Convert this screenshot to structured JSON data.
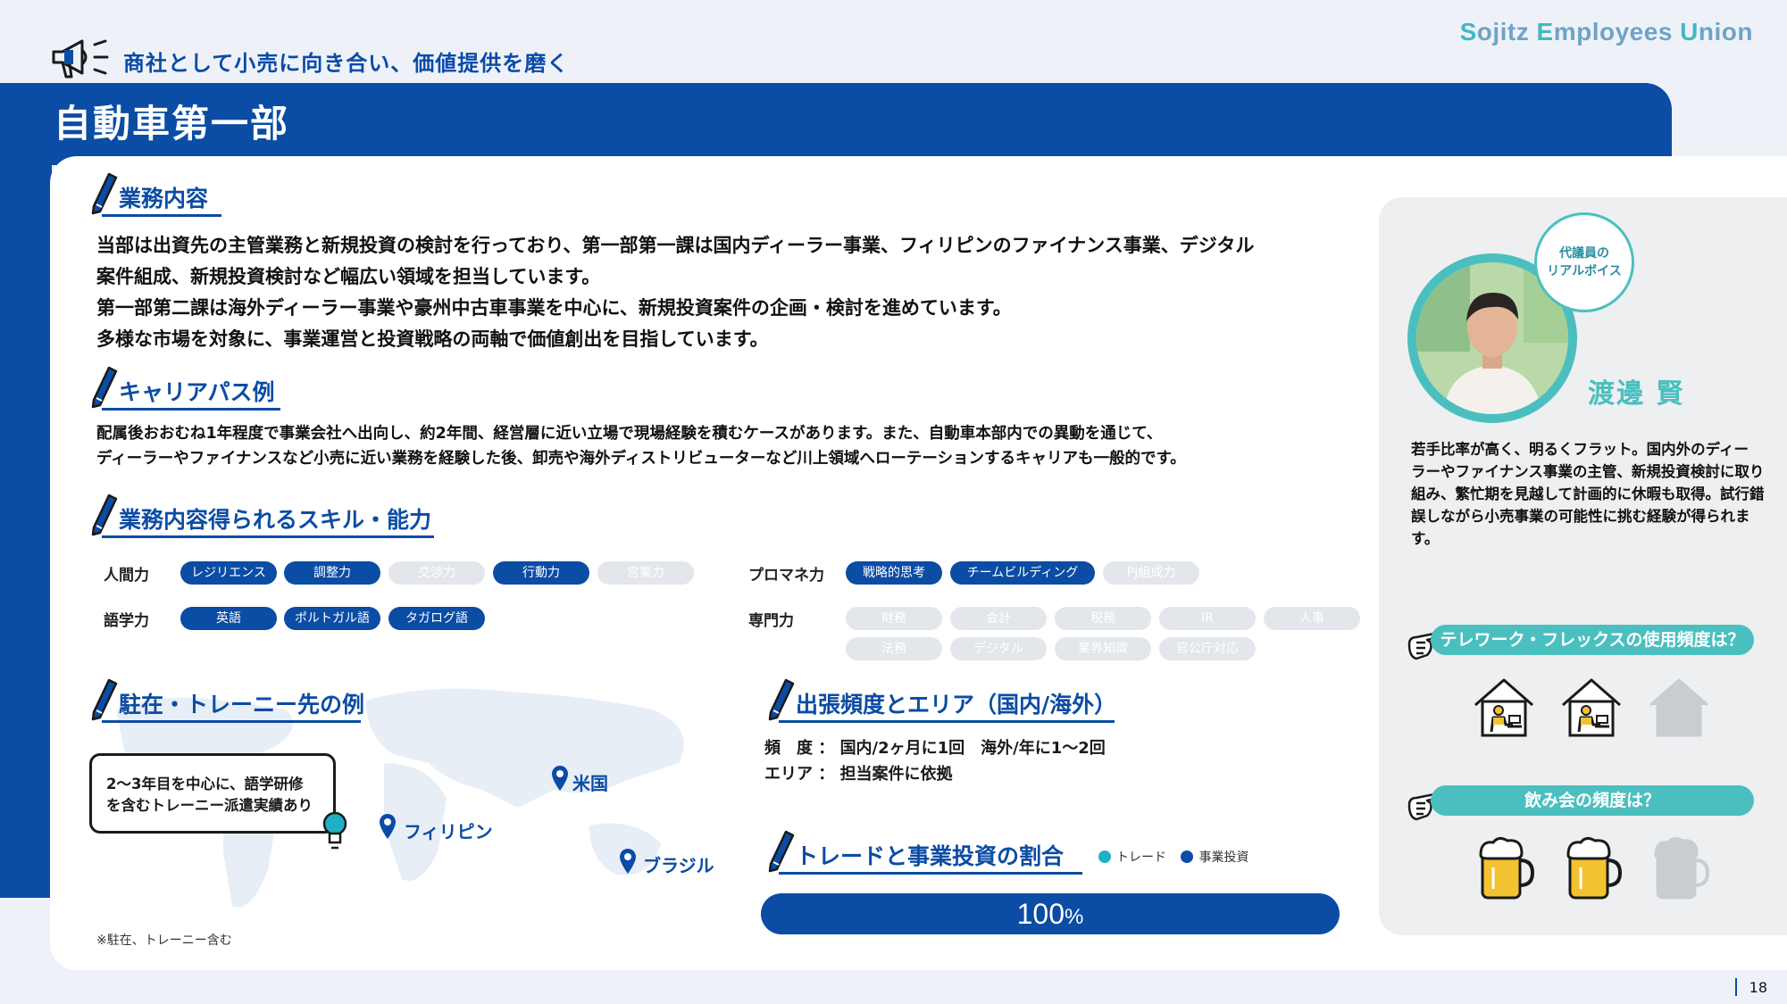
{
  "header": {
    "tagline": "商社として小売に向き合い、価値提供を磨く",
    "brand": {
      "s1": "S",
      "t1": "ojitz ",
      "s2": "E",
      "t2": "mployees ",
      "s3": "U",
      "t3": "nion"
    },
    "page_title": "自動車第一部"
  },
  "sections": {
    "business": {
      "title": "業務内容",
      "lines": [
        "当部は出資先の主管業務と新規投資の検討を行っており、第一部第一課は国内ディーラー事業、フィリピンのファイナンス事業、デジタル",
        "案件組成、新規投資検討など幅広い領域を担当しています。",
        "第一部第二課は海外ディーラー事業や豪州中古車事業を中心に、新規投資案件の企画・検討を進めています。",
        "多様な市場を対象に、事業運営と投資戦略の両軸で価値創出を目指しています。"
      ]
    },
    "career": {
      "title": "キャリアパス例",
      "lines": [
        "配属後おおむね1年程度で事業会社へ出向し、約2年間、経営層に近い立場で現場経験を積むケースがあります。また、自動車本部内での異動を通じて、",
        "ディーラーやファイナンスなど小売に近い業務を経験した後、卸売や海外ディストリビューターなど川上領域へローテーションするキャリアも一般的です。"
      ]
    },
    "skills": {
      "title": "業務内容得られるスキル・能力",
      "groups": [
        {
          "label": "人間力",
          "items": [
            {
              "text": "レジリエンス",
              "on": true
            },
            {
              "text": "調整力",
              "on": true
            },
            {
              "text": "交渉力",
              "on": false
            },
            {
              "text": "行動力",
              "on": true
            },
            {
              "text": "営業力",
              "on": false
            }
          ]
        },
        {
          "label": "語学力",
          "items": [
            {
              "text": "英語",
              "on": true
            },
            {
              "text": "ポルトガル語",
              "on": true
            },
            {
              "text": "タガログ語",
              "on": true
            }
          ]
        },
        {
          "label": "プロマネ力",
          "items": [
            {
              "text": "戦略的思考",
              "on": true
            },
            {
              "text": "チームビルディング",
              "on": true
            },
            {
              "text": "PJ組成力",
              "on": false
            }
          ]
        },
        {
          "label": "専門力",
          "items": [
            {
              "text": "財務",
              "on": false
            },
            {
              "text": "会計",
              "on": false
            },
            {
              "text": "税務",
              "on": false
            },
            {
              "text": "IR",
              "on": false
            },
            {
              "text": "人事",
              "on": false
            },
            {
              "text": "法務",
              "on": false
            },
            {
              "text": "デジタル",
              "on": false
            },
            {
              "text": "業界知識",
              "on": false
            },
            {
              "text": "官公庁対応",
              "on": false
            }
          ]
        }
      ]
    },
    "trainee": {
      "title": "駐在・トレーニー先の例",
      "note": [
        "2～3年目を中心に、語学研修",
        "を含むトレーニー派遣実績あり"
      ],
      "pins": [
        "米国",
        "フィリピン",
        "ブラジル"
      ],
      "footnote": "※駐在、トレーニー含む"
    },
    "travel": {
      "title": "出張頻度とエリア（国内/海外）",
      "freq_label": "頻　度",
      "freq_value": "国内/2ヶ月に1回　海外/年に1～2回",
      "area_label": "エリア",
      "area_value": "担当案件に依拠",
      "colon": "："
    },
    "ratio": {
      "title": "トレードと事業投資の割合",
      "legend": [
        {
          "label": "トレード",
          "color": "#1fb0c6"
        },
        {
          "label": "事業投資",
          "color": "#0b4ca4"
        }
      ],
      "value": "100",
      "unit": "%",
      "invest_share": 1.0
    }
  },
  "voice": {
    "bubble_l1": "代議員の",
    "bubble_l2": "リアルボイス",
    "name": "渡邊 賢",
    "lines": [
      "若手比率が高く、明るくフラット。国内外のディー",
      "ラーやファイナンス事業の主管、新規投資検討に取り",
      "組み、繁忙期を見越して計画的に休暇も取得。試行錯",
      "誤しながら小売事業の可能性に挑む経験が得られま",
      "す。"
    ],
    "q1": {
      "text": "テレワーク・フレックスの使用頻度は？",
      "level": 2,
      "max": 3,
      "icon": "remote-work-icon"
    },
    "q2": {
      "text": "飲み会の頻度は？",
      "level": 2,
      "max": 3,
      "icon": "beer-mug-icon"
    }
  },
  "colors": {
    "primary": "#0b4ca4",
    "teal": "#4bbfbf",
    "pill_off": "#e3e6ea"
  },
  "page_number": "18"
}
